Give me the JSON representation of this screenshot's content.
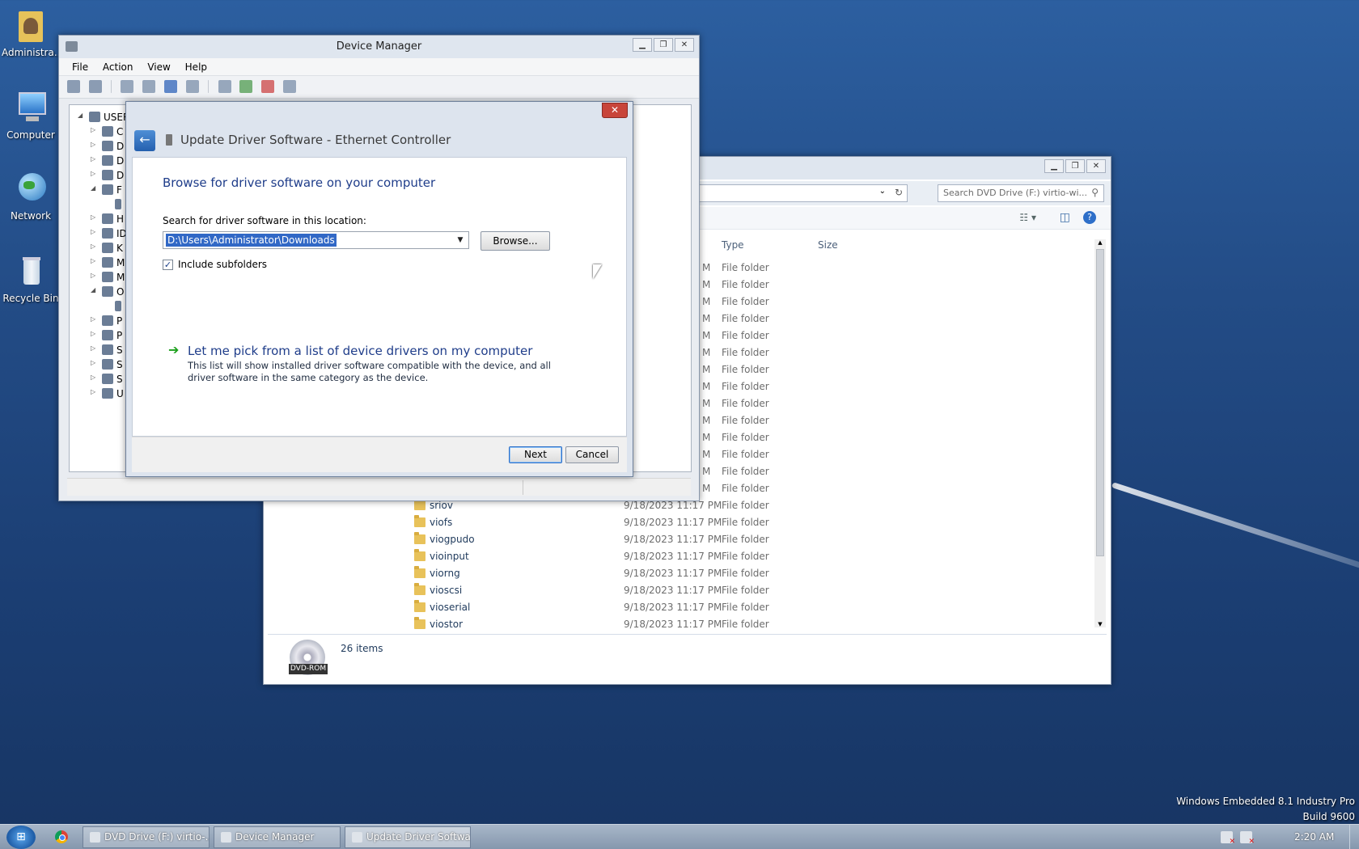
{
  "desktop": {
    "icons": [
      {
        "label": "Administra...",
        "icon": "user-folder-icon"
      },
      {
        "label": "Computer",
        "icon": "computer-icon"
      },
      {
        "label": "Network",
        "icon": "network-globe-icon"
      },
      {
        "label": "Recycle Bin",
        "icon": "recycle-bin-icon"
      }
    ],
    "watermark": {
      "line1": "Windows Embedded 8.1 Industry Pro",
      "line2": "Build 9600"
    }
  },
  "explorer": {
    "search_placeholder": "Search DVD Drive (F:) virtio-wi...",
    "columns": {
      "type": "Type",
      "size": "Size"
    },
    "hidden_rows_type": "File folder",
    "hidden_rows_date_suffix": "M",
    "rows": [
      {
        "name": "sriov",
        "date": "9/18/2023 11:17 PM",
        "type": "File folder"
      },
      {
        "name": "viofs",
        "date": "9/18/2023 11:17 PM",
        "type": "File folder"
      },
      {
        "name": "viogpudo",
        "date": "9/18/2023 11:17 PM",
        "type": "File folder"
      },
      {
        "name": "vioinput",
        "date": "9/18/2023 11:17 PM",
        "type": "File folder"
      },
      {
        "name": "viorng",
        "date": "9/18/2023 11:17 PM",
        "type": "File folder"
      },
      {
        "name": "vioscsi",
        "date": "9/18/2023 11:17 PM",
        "type": "File folder"
      },
      {
        "name": "vioserial",
        "date": "9/18/2023 11:17 PM",
        "type": "File folder"
      },
      {
        "name": "viostor",
        "date": "9/18/2023 11:17 PM",
        "type": "File folder"
      }
    ],
    "status": {
      "items": "26 items",
      "drive_label": "DVD-ROM"
    }
  },
  "device_manager": {
    "title": "Device Manager",
    "menu": [
      "File",
      "Action",
      "View",
      "Help"
    ],
    "tree_root": "USER",
    "tree_letters": [
      "C",
      "D",
      "D",
      "D",
      "F",
      "",
      "H",
      "ID",
      "K",
      "M",
      "M",
      "O",
      "",
      "P",
      "P",
      "S",
      "S",
      "S",
      "U"
    ]
  },
  "dialog": {
    "title": "Update Driver Software - Ethernet Controller",
    "heading": "Browse for driver software on your computer",
    "search_label": "Search for driver software in this location:",
    "path_value": "D:\\Users\\Administrator\\Downloads",
    "browse_label": "Browse...",
    "include_subfolders_label": "Include subfolders",
    "include_subfolders_checked": true,
    "pick_link": "Let me pick from a list of device drivers on my computer",
    "pick_desc": "This list will show installed driver software compatible with the device, and all driver software in the same category as the device.",
    "next_label": "Next",
    "cancel_label": "Cancel"
  },
  "taskbar": {
    "buttons": [
      {
        "label": "DVD Drive (F:) virtio-...",
        "active": false
      },
      {
        "label": "Device Manager",
        "active": false
      },
      {
        "label": "Update Driver Softwa...",
        "active": true
      }
    ],
    "clock": "2:20 AM"
  }
}
